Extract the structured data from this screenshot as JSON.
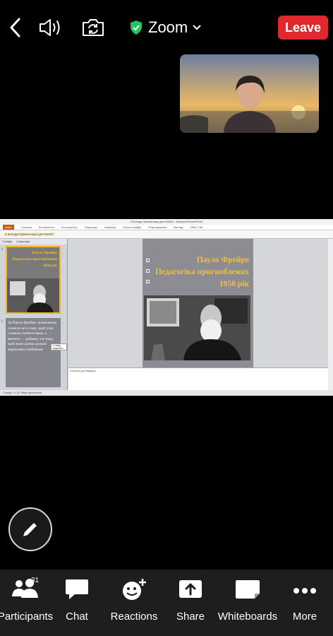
{
  "header": {
    "title": "Zoom",
    "leave_label": "Leave",
    "icons": [
      "chevron-left-icon",
      "speaker-icon",
      "camera-switch-icon",
      "shield-check-icon",
      "chevron-down-icon"
    ],
    "accent": "#e0282f",
    "secure_color": "#22c55e"
  },
  "shared_screen": {
    "window_title": "9 Колода Презентація для МАКО - Microsoft PowerPoint",
    "ribbon_tabs": [
      "Файл",
      "Головна",
      "Вставлення",
      "Конструктор",
      "Переходи",
      "Анімація",
      "Показ слайдів",
      "Рецензування",
      "Вигляд",
      "Office Tab"
    ],
    "document_name": "9 Колода Презентація для МАКО",
    "panel_tabs": [
      "Слайди",
      "Структура"
    ],
    "slide_title_lines": [
      "Пауло Фрейре",
      "Педагогіка пригноблених",
      "1958 рік"
    ],
    "thumb1_title_lines": [
      "Пауло Фрейре",
      "Педагогіка пригноблених",
      "1958 рік"
    ],
    "thumb2_text": "За Пауло Фрейре, визволення полягає не в тому, щоб учні ставали гнобителями, а вчителі — рабами, а в тому, щоб вони разом долали відносини гноблення",
    "tooltip": "Слайд, виділено",
    "notes_placeholder": "Нотатки доповідача",
    "status_text": "Слайд 1 з 10   Тема   українська",
    "slide_numbers": [
      "1",
      "2"
    ]
  },
  "annotate": {
    "icon": "pencil-icon"
  },
  "toolbar": {
    "participants_label": "Participants",
    "participants_count": "31",
    "chat_label": "Chat",
    "reactions_label": "Reactions",
    "share_label": "Share",
    "whiteboards_label": "Whiteboards",
    "more_label": "More"
  }
}
